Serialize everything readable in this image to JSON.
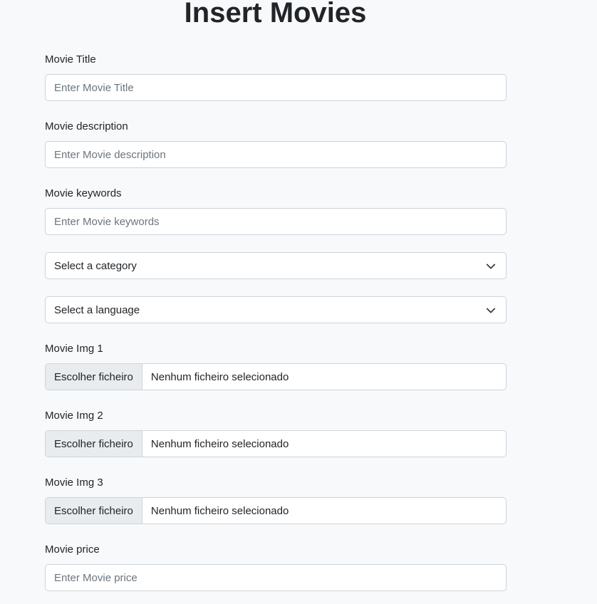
{
  "page": {
    "title": "Insert Movies"
  },
  "form": {
    "title_field": {
      "label": "Movie Title",
      "placeholder": "Enter Movie Title",
      "value": ""
    },
    "description_field": {
      "label": "Movie description",
      "placeholder": "Enter Movie description",
      "value": ""
    },
    "keywords_field": {
      "label": "Movie keywords",
      "placeholder": "Enter Movie keywords",
      "value": ""
    },
    "category_select": {
      "selected": "Select a category"
    },
    "language_select": {
      "selected": "Select a language"
    },
    "img1": {
      "label": "Movie Img 1",
      "button": "Escolher ficheiro",
      "status": "Nenhum ficheiro selecionado"
    },
    "img2": {
      "label": "Movie Img 2",
      "button": "Escolher ficheiro",
      "status": "Nenhum ficheiro selecionado"
    },
    "img3": {
      "label": "Movie Img 3",
      "button": "Escolher ficheiro",
      "status": "Nenhum ficheiro selecionado"
    },
    "price_field": {
      "label": "Movie price",
      "placeholder": "Enter Movie price",
      "value": ""
    }
  },
  "icons": {
    "select_chevron": "chevron-down-icon"
  }
}
